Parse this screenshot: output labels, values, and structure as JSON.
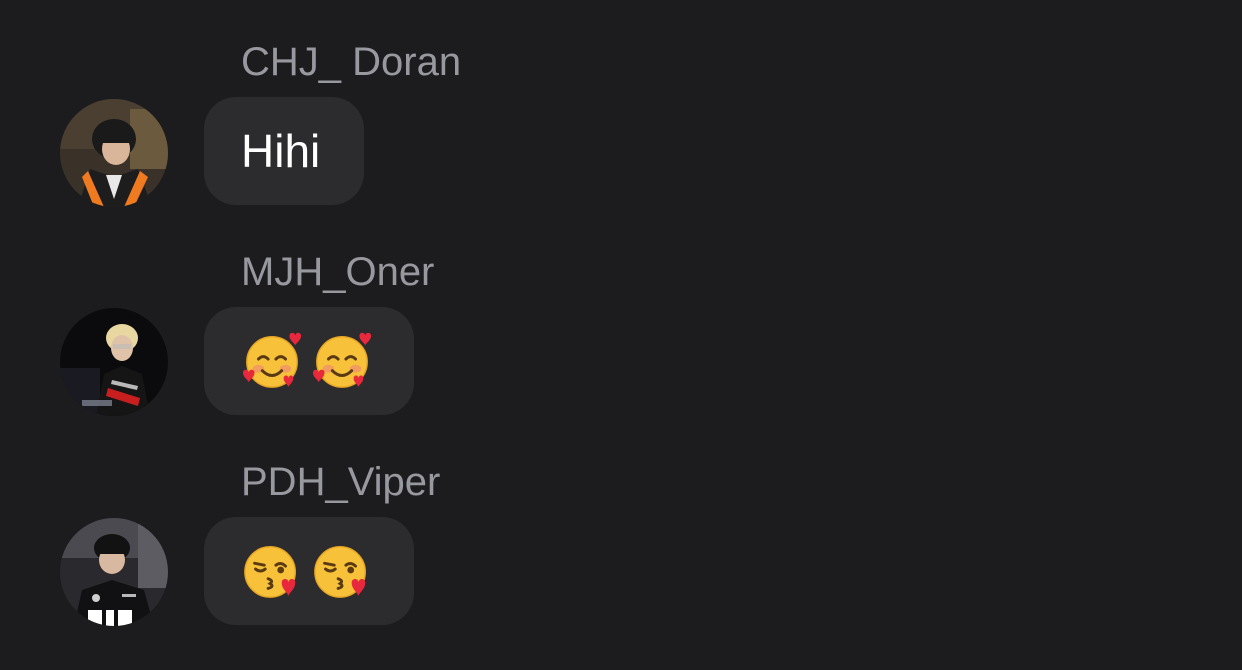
{
  "messages": [
    {
      "sender": "CHJ_ Doran",
      "text": "Hihi",
      "avatar": "player-photo-avatar-orange"
    },
    {
      "sender": "MJH_Oner",
      "emojis": [
        "smiling-face-with-hearts-icon",
        "smiling-face-with-hearts-icon"
      ],
      "avatar": "player-photo-avatar-blonde"
    },
    {
      "sender": "PDH_Viper",
      "emojis": [
        "face-blowing-kiss-icon",
        "face-blowing-kiss-icon"
      ],
      "avatar": "player-photo-avatar-dark"
    }
  ],
  "colors": {
    "background": "#1c1c1e",
    "bubble": "#2c2c2e",
    "sender_name": "#98989f",
    "message_text": "#ffffff"
  }
}
